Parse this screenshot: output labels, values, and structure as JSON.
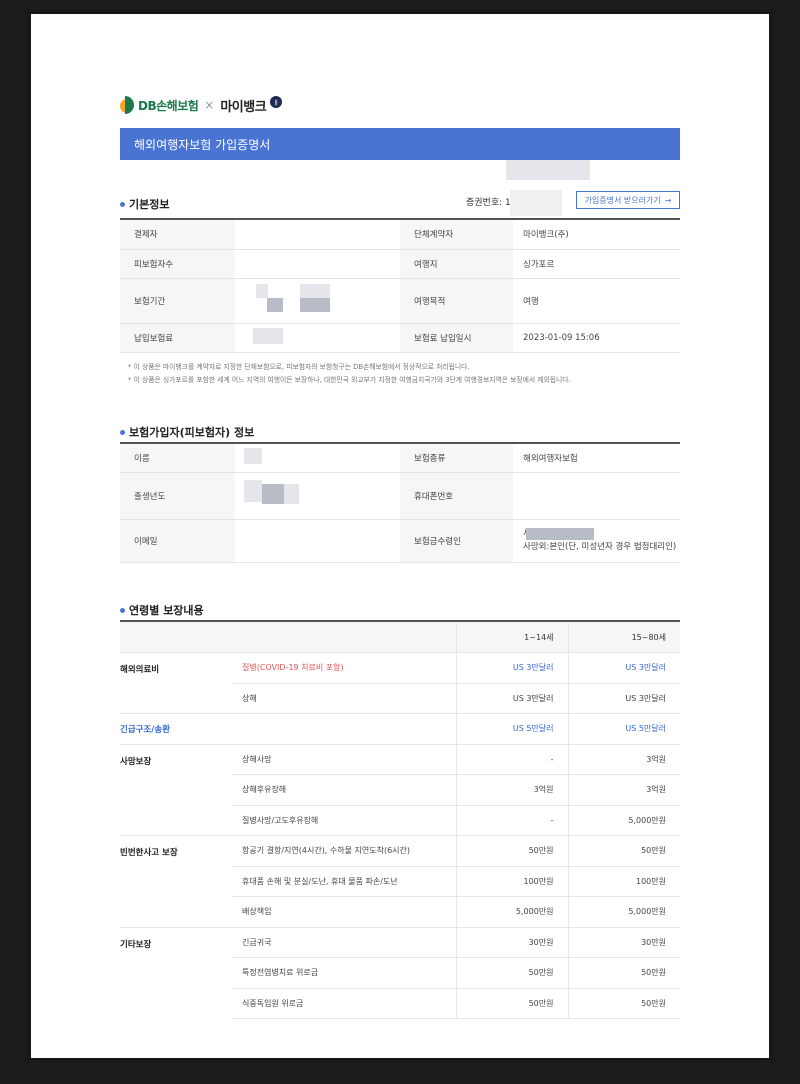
{
  "logos": {
    "insurer": "DB손해보험",
    "separator": "×",
    "partner": "마이뱅크",
    "badge": "ㅐ"
  },
  "title": "해외여행자보험 가입증명서",
  "basic": {
    "heading": "기본정보",
    "policy_no_label": "증권번호: 1",
    "cert_button": "가입증명서 받으러가기",
    "rows": [
      {
        "l1": "결제자",
        "v1": "",
        "l2": "단체계약자",
        "v2": "마이뱅크(주)"
      },
      {
        "l1": "피보험자수",
        "v1": "",
        "l2": "여행지",
        "v2": "싱가포르"
      },
      {
        "l1": "보험기간",
        "v1": "",
        "l2": "여행목적",
        "v2": "여행"
      },
      {
        "l1": "납입보험료",
        "v1": "",
        "l2": "보험료 납입일시",
        "v2": "2023-01-09 15:06"
      }
    ],
    "notes": [
      "* 이 상품은 마이뱅크를 계약자로 지정한 단체보험으로, 피보험자의 보험청구는 DB손해보험에서 정상적으로 처리됩니다.",
      "* 이 상품은 싱가포르를 포함한 세계 어느 지역의 여행이든 보장하나, 대한민국 외교부가 지정한 여행금지국가와 3단계 여행경보지역은 보장에서 제외됩니다."
    ]
  },
  "insured": {
    "heading": "보험가입자(피보험자) 정보",
    "rows": [
      {
        "l1": "이름",
        "v1": "",
        "l2": "보험종류",
        "v2": "해외여행자보험"
      },
      {
        "l1": "출생년도",
        "v1": "",
        "l2": "휴대폰번호",
        "v2": ""
      },
      {
        "l1": "이메일",
        "v1": "",
        "l2": "보험금수령인",
        "v2": "사망시:법정상속인",
        "v3": "사망외:본인(단, 미성년자 경우 법정대리인)"
      }
    ]
  },
  "coverage": {
    "heading": "연령별 보장내용",
    "age_cols": [
      "1~14세",
      "15~80세"
    ],
    "groups": [
      {
        "category": "해외의료비",
        "items": [
          {
            "name": "질병(COVID-19 치료비 포함)",
            "a": "US 3만달러",
            "b": "US 3만달러"
          },
          {
            "name": "상해",
            "a": "US 3만달러",
            "b": "US 3만달러"
          }
        ]
      },
      {
        "category": "긴급구조/송환",
        "items": [
          {
            "name": "",
            "a": "US 5만달러",
            "b": "US 5만달러"
          }
        ]
      },
      {
        "category": "사망보장",
        "items": [
          {
            "name": "상해사망",
            "a": "-",
            "b": "3억원"
          },
          {
            "name": "상해후유장해",
            "a": "3억원",
            "b": "3억원"
          },
          {
            "name": "질병사망/고도후유장해",
            "a": "-",
            "b": "5,000만원"
          }
        ]
      },
      {
        "category": "빈번한사고 보장",
        "items": [
          {
            "name": "항공기 결항/지연(4시간), 수하물 지연도착(6시간)",
            "a": "50만원",
            "b": "50만원"
          },
          {
            "name": "휴대품 손해 및 분실/도난, 휴대 물품 파손/도난",
            "a": "100만원",
            "b": "100만원"
          },
          {
            "name": "배상책임",
            "a": "5,000만원",
            "b": "5,000만원"
          }
        ]
      },
      {
        "category": "기타보장",
        "items": [
          {
            "name": "긴급귀국",
            "a": "30만원",
            "b": "30만원"
          },
          {
            "name": "특정전염병치료 위로금",
            "a": "50만원",
            "b": "50만원"
          },
          {
            "name": "식중독입원 위로금",
            "a": "50만원",
            "b": "50만원"
          }
        ]
      }
    ]
  },
  "colors": {
    "accent": "#4a74d3",
    "highlight_red": "#e05555",
    "page_bg": "#1c1c1c"
  }
}
